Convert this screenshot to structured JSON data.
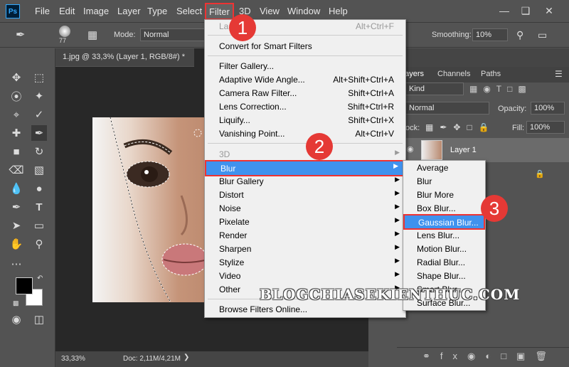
{
  "app": {
    "logo": "Ps"
  },
  "menubar": [
    {
      "id": "file",
      "label": "File"
    },
    {
      "id": "edit",
      "label": "Edit"
    },
    {
      "id": "image",
      "label": "Image"
    },
    {
      "id": "layer",
      "label": "Layer"
    },
    {
      "id": "type",
      "label": "Type"
    },
    {
      "id": "select",
      "label": "Select"
    },
    {
      "id": "filter",
      "label": "Filter"
    },
    {
      "id": "3d",
      "label": "3D"
    },
    {
      "id": "view",
      "label": "View"
    },
    {
      "id": "window",
      "label": "Window"
    },
    {
      "id": "help",
      "label": "Help"
    }
  ],
  "options": {
    "brush_size": "77",
    "mode_label": "Mode:",
    "mode_value": "Normal",
    "smoothing_label": "Smoothing:",
    "smoothing_value": "10%"
  },
  "document": {
    "tab_title": "1.jpg @ 33,3% (Layer 1, RGB/8#) *",
    "zoom": "33,33%",
    "doc_size": "Doc: 2,11M/4,21M"
  },
  "layers_panel": {
    "tabs": [
      "Layers",
      "Channels",
      "Paths"
    ],
    "kind": "Kind",
    "blend_mode": "Normal",
    "opacity_label": "Opacity:",
    "opacity": "100%",
    "lock_label": "ock:",
    "fill_label": "Fill:",
    "fill": "100%",
    "layer_name": "Layer 1"
  },
  "filter_menu": {
    "items": [
      {
        "label": "La",
        "shortcut": "Alt+Ctrl+F",
        "disabled": true
      },
      {
        "label": "Convert for Smart Filters"
      },
      {
        "label": "Filter Gallery..."
      },
      {
        "label": "Adaptive Wide Angle...",
        "shortcut": "Alt+Shift+Ctrl+A"
      },
      {
        "label": "Camera Raw Filter...",
        "shortcut": "Shift+Ctrl+A"
      },
      {
        "label": "Lens Correction...",
        "shortcut": "Shift+Ctrl+R"
      },
      {
        "label": "Liquify...",
        "shortcut": "Shift+Ctrl+X"
      },
      {
        "label": "Vanishing Point...",
        "shortcut": "Alt+Ctrl+V"
      },
      {
        "label": "3D",
        "disabled": true
      },
      {
        "label": "Blur",
        "highlighted": true
      },
      {
        "label": "Blur Gallery"
      },
      {
        "label": "Distort"
      },
      {
        "label": "Noise"
      },
      {
        "label": "Pixelate"
      },
      {
        "label": "Render"
      },
      {
        "label": "Sharpen"
      },
      {
        "label": "Stylize"
      },
      {
        "label": "Video"
      },
      {
        "label": "Other"
      },
      {
        "label": "Browse Filters Online..."
      }
    ]
  },
  "blur_menu": {
    "items": [
      {
        "label": "Average"
      },
      {
        "label": "Blur"
      },
      {
        "label": "Blur More"
      },
      {
        "label": "Box Blur..."
      },
      {
        "label": "Gaussian Blur...",
        "highlighted": true
      },
      {
        "label": "Lens Blur..."
      },
      {
        "label": "Motion Blur..."
      },
      {
        "label": "Radial Blur..."
      },
      {
        "label": "Shape Blur..."
      },
      {
        "label": "Smart Blur..."
      },
      {
        "label": "Surface Blur..."
      }
    ]
  },
  "badges": [
    "1",
    "2",
    "3"
  ],
  "watermark": "BLOGCHIASEKIENTHUC.COM",
  "colors": {
    "highlight": "#3f92ee",
    "badge": "#e53935",
    "accent_box": "#e33333"
  }
}
